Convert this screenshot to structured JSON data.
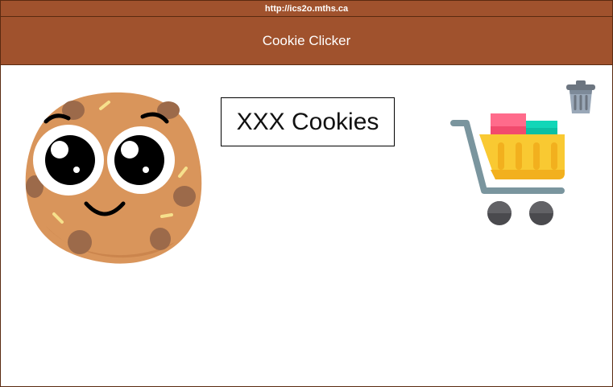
{
  "browser": {
    "url": "http://ics2o.mths.ca"
  },
  "app": {
    "title": "Cookie Clicker"
  },
  "counter": {
    "label": "XXX Cookies"
  },
  "icons": {
    "cookie": "cookie-icon",
    "cart": "shopping-cart-icon",
    "trash": "trash-icon"
  },
  "colors": {
    "header": "#a0522d",
    "border": "#5a2a10",
    "cookie": "#d9955b",
    "cart_basket": "#f9c932",
    "cart_frame": "#7a959e",
    "trash": "#9aa8b8"
  }
}
